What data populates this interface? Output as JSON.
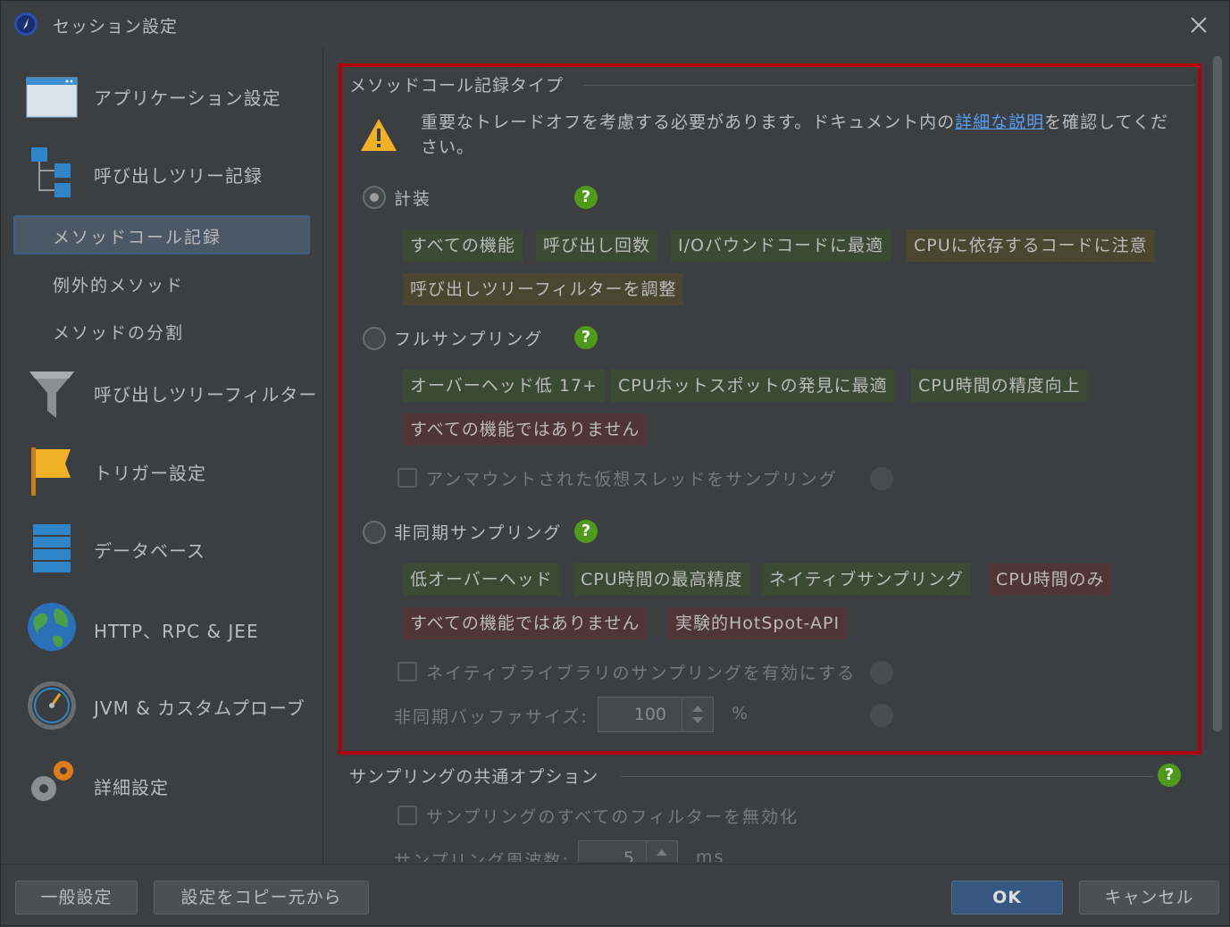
{
  "window": {
    "title": "セッション設定"
  },
  "sidebar": {
    "items": [
      {
        "label": "アプリケーション設定",
        "icon": "application-window-icon"
      },
      {
        "label": "呼び出しツリー記録",
        "icon": "call-tree-icon"
      },
      {
        "label": "呼び出しツリーフィルター",
        "icon": "funnel-icon"
      },
      {
        "label": "トリガー設定",
        "icon": "flag-icon"
      },
      {
        "label": "データベース",
        "icon": "database-icon"
      },
      {
        "label": "HTTP、RPC & JEE",
        "icon": "globe-icon"
      },
      {
        "label": "JVM & カスタムプローブ",
        "icon": "gauge-icon"
      },
      {
        "label": "詳細設定",
        "icon": "gears-icon"
      }
    ],
    "subitems": [
      {
        "label": "メソッドコール記録",
        "selected": true
      },
      {
        "label": "例外的メソッド",
        "selected": false
      },
      {
        "label": "メソッドの分割",
        "selected": false
      }
    ]
  },
  "main": {
    "section_title": "メソッドコール記録タイプ",
    "warning": {
      "before": "重要なトレードオフを考慮する必要があります。ドキュメント内の",
      "link": "詳細な説明",
      "after": "を確認してください。"
    },
    "instrumentation": {
      "label": "計装",
      "selected": true,
      "tags": [
        {
          "text": "すべての機能",
          "tone": "good"
        },
        {
          "text": "呼び出し回数",
          "tone": "good"
        },
        {
          "text": "I/Oバウンドコードに最適",
          "tone": "good"
        },
        {
          "text": "CPUに依存するコードに注意",
          "tone": "caution"
        },
        {
          "text": "呼び出しツリーフィルターを調整",
          "tone": "caution"
        }
      ]
    },
    "full_sampling": {
      "label": "フルサンプリング",
      "selected": false,
      "tags": [
        {
          "text": "オーバーヘッド低 17+",
          "tone": "good"
        },
        {
          "text": "CPUホットスポットの発見に最適",
          "tone": "good"
        },
        {
          "text": "CPU時間の精度向上",
          "tone": "good"
        },
        {
          "text": "すべての機能ではありません",
          "tone": "bad"
        }
      ],
      "checkbox_label": "アンマウントされた仮想スレッドをサンプリング"
    },
    "async_sampling": {
      "label": "非同期サンプリング",
      "selected": false,
      "tags": [
        {
          "text": "低オーバーヘッド",
          "tone": "good"
        },
        {
          "text": "CPU時間の最高精度",
          "tone": "good"
        },
        {
          "text": "ネイティブサンプリング",
          "tone": "good"
        },
        {
          "text": "CPU時間のみ",
          "tone": "bad"
        },
        {
          "text": "すべての機能ではありません",
          "tone": "bad"
        },
        {
          "text": "実験的HotSpot-API",
          "tone": "bad"
        }
      ],
      "checkbox_label": "ネイティブライブラリのサンプリングを有効にする",
      "buffer_label": "非同期バッファサイズ:",
      "buffer_value": "100",
      "buffer_unit": "%"
    },
    "common": {
      "section_title": "サンプリングの共通オプション",
      "checkbox_label": "サンプリングのすべてのフィルターを無効化",
      "frequency_label": "サンプリング周波数:",
      "frequency_value": "5",
      "frequency_unit": "ms"
    }
  },
  "buttons": {
    "general": "一般設定",
    "copy_from": "設定をコピー元から",
    "ok": "OK",
    "cancel": "キャンセル"
  },
  "colors": {
    "accent": "#365880",
    "help": "#4e9a1a",
    "highlight": "#b0000e",
    "link": "#589df6"
  }
}
